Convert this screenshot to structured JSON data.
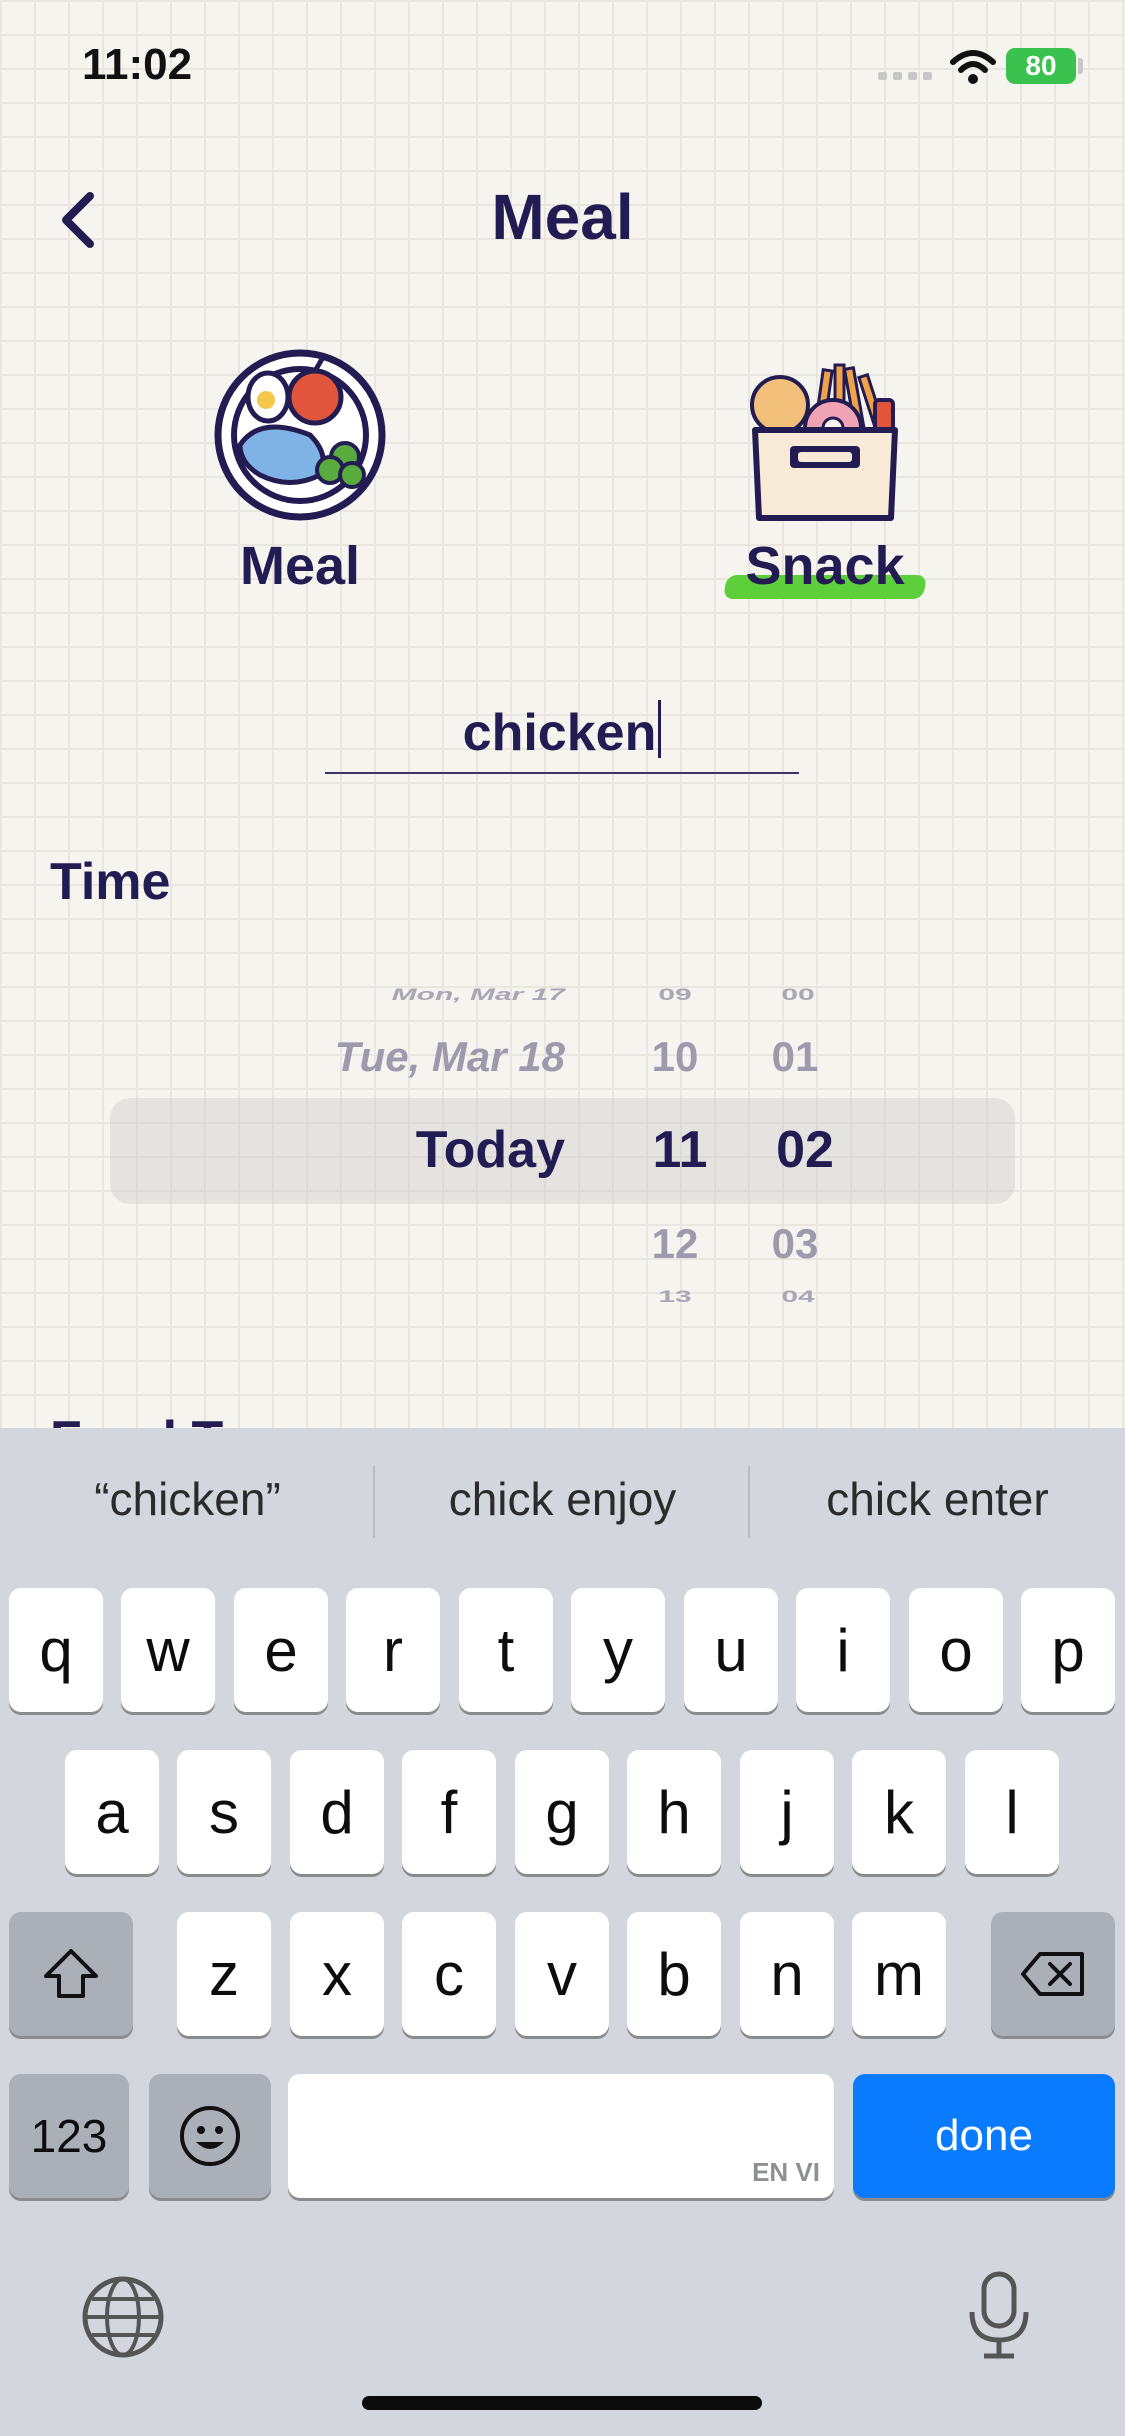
{
  "status_bar": {
    "time": "11:02",
    "battery": "80"
  },
  "header": {
    "title": "Meal"
  },
  "meal_types": [
    {
      "label": "Meal",
      "selected": false
    },
    {
      "label": "Snack",
      "selected": true
    }
  ],
  "search": {
    "value": "chicken"
  },
  "time": {
    "label": "Time",
    "dates": [
      "Mon, Mar 17",
      "Tue, Mar 18",
      "Today"
    ],
    "hours": [
      "09",
      "10",
      "11",
      "12",
      "13"
    ],
    "minutes": [
      "00",
      "01",
      "02",
      "03",
      "04"
    ]
  },
  "food_type_label": "Food Type",
  "keyboard": {
    "suggestions": [
      "“chicken”",
      "chick enjoy",
      "chick enter"
    ],
    "row1": [
      "q",
      "w",
      "e",
      "r",
      "t",
      "y",
      "u",
      "i",
      "o",
      "p"
    ],
    "row2": [
      "a",
      "s",
      "d",
      "f",
      "g",
      "h",
      "j",
      "k",
      "l"
    ],
    "row3": [
      "z",
      "x",
      "c",
      "v",
      "b",
      "n",
      "m"
    ],
    "numbers_key": "123",
    "space_lang": "EN VI",
    "done_key": "done"
  },
  "colors": {
    "accent": "#0a7bff",
    "text": "#231c52",
    "highlight": "#5ccf3a",
    "battery": "#3ac24e"
  }
}
